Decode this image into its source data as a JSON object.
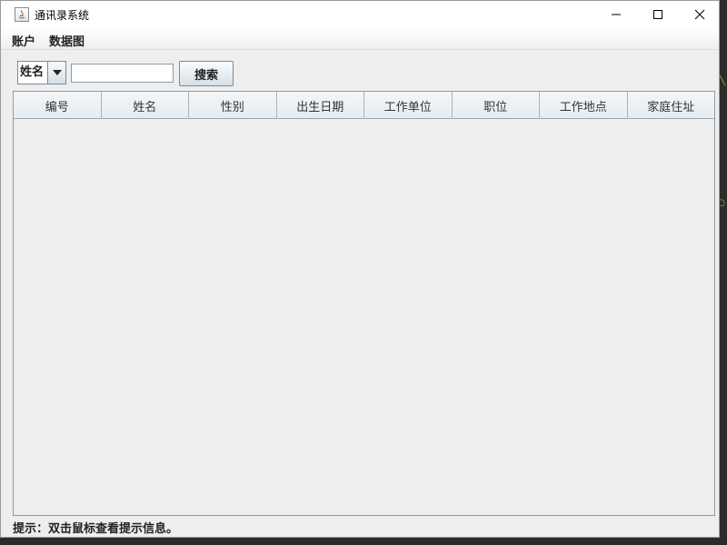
{
  "window": {
    "title": "通讯录系统",
    "controls": {
      "minimize": "minimize-icon",
      "maximize": "maximize-icon",
      "close": "close-icon"
    }
  },
  "menubar": {
    "items": [
      {
        "label": "账户"
      },
      {
        "label": "数据图"
      }
    ]
  },
  "search": {
    "field_selector": {
      "selected": "姓名"
    },
    "query": "",
    "button_label": "搜索"
  },
  "table": {
    "columns": [
      "编号",
      "姓名",
      "性别",
      "出生日期",
      "工作单位",
      "职位",
      "工作地点",
      "家庭住址"
    ],
    "rows": []
  },
  "status": {
    "hint": "提示：双击鼠标查看提示信息。"
  },
  "colors": {
    "accent": "#7a8a99",
    "window_bg": "#eeeeee",
    "titlebar_bg": "#ffffff"
  }
}
